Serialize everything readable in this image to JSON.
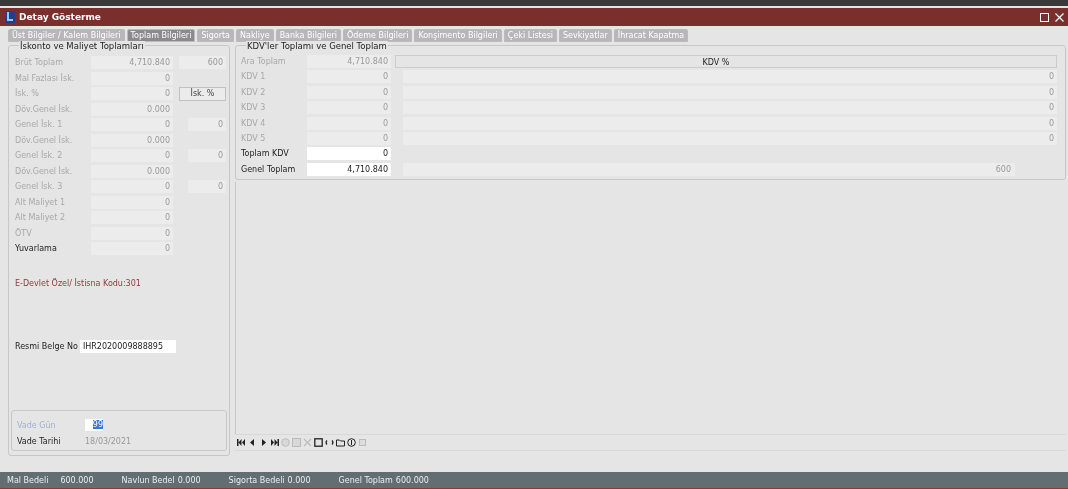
{
  "window": {
    "title": "Detay Gösterme"
  },
  "tabs": [
    {
      "label": "Üst Bilgiler / Kalem Bilgileri",
      "selected": false
    },
    {
      "label": "Toplam Bilgileri",
      "selected": true
    },
    {
      "label": "Sigorta",
      "selected": false
    },
    {
      "label": "Nakliye",
      "selected": false
    },
    {
      "label": "Banka Bilgileri",
      "selected": false
    },
    {
      "label": "Ödeme Bilgileri",
      "selected": false
    },
    {
      "label": "Konşimento Bilgileri",
      "selected": false
    },
    {
      "label": "Çeki Listesi",
      "selected": false
    },
    {
      "label": "Sevkiyatlar",
      "selected": false
    },
    {
      "label": "İhracat Kapatma",
      "selected": false
    }
  ],
  "discount_panel": {
    "title": "İskonto ve Maliyet Toplamları",
    "rows": [
      {
        "label": "Brüt Toplam",
        "value": "4,710.840",
        "disabled": true,
        "extra": {
          "kind": "field",
          "text": "600"
        }
      },
      {
        "label": "Mal Fazlası İsk.",
        "value": "0",
        "disabled": true
      },
      {
        "label": "İsk. %",
        "value": "0",
        "disabled": true,
        "extra": {
          "kind": "button",
          "text": "İsk. %"
        }
      },
      {
        "label": "Döv.Genel İsk.",
        "value": "0.000",
        "disabled": true
      },
      {
        "label": "Genel İsk. 1",
        "value": "0",
        "disabled": true,
        "extra": {
          "kind": "field",
          "text": "0"
        }
      },
      {
        "label": "Döv.Genel İsk.",
        "value": "0.000",
        "disabled": true
      },
      {
        "label": "Genel İsk. 2",
        "value": "0",
        "disabled": true,
        "extra": {
          "kind": "field",
          "text": "0"
        }
      },
      {
        "label": "Döv.Genel İsk.",
        "value": "0.000",
        "disabled": true
      },
      {
        "label": "Genel İsk. 3",
        "value": "0",
        "disabled": true,
        "extra": {
          "kind": "field",
          "text": "0"
        }
      },
      {
        "label": "Alt Maliyet 1",
        "value": "0",
        "disabled": true
      },
      {
        "label": "Alt Maliyet 2",
        "value": "0",
        "disabled": true
      },
      {
        "label": "ÖTV",
        "value": "0",
        "disabled": true
      },
      {
        "label": "Yuvarlama",
        "value": "0",
        "disabled": false
      }
    ],
    "note": "E-Devlet Özel/ İstisna Kodu:301",
    "document": {
      "label": "Resmi Belge No",
      "value": "IHR2020009888895"
    },
    "due": {
      "days_label": "Vade Gün",
      "days_value": "99",
      "days_disabled": true,
      "date_label": "Vade Tarihi",
      "date_value": "18/03/2021"
    }
  },
  "vat_panel": {
    "title": "KDV'ler Toplamı ve Genel Toplam",
    "rate_header": "KDV %",
    "rows": [
      {
        "label": "Ara Toplam",
        "value": "4,710.840",
        "disabled": true
      },
      {
        "label": "KDV 1",
        "value": "0",
        "disabled": true,
        "rate": "0"
      },
      {
        "label": "KDV 2",
        "value": "0",
        "disabled": true,
        "rate": "0"
      },
      {
        "label": "KDV 3",
        "value": "0",
        "disabled": true,
        "rate": "0"
      },
      {
        "label": "KDV 4",
        "value": "0",
        "disabled": true,
        "rate": "0"
      },
      {
        "label": "KDV 5",
        "value": "0",
        "disabled": true,
        "rate": "0"
      },
      {
        "label": "Toplam KDV",
        "value": "0",
        "disabled": false
      },
      {
        "label": "Genel Toplam",
        "value": "4,710.840",
        "disabled": false,
        "rate": "600"
      }
    ]
  },
  "status_bar": [
    {
      "label": "Mal Bedeli",
      "value": "600.000"
    },
    {
      "label": "Navlun Bedel",
      "value": "0.000"
    },
    {
      "label": "Sigorta Bedeli",
      "value": "0.000"
    },
    {
      "label": "Genel Toplam",
      "value": "600.000"
    }
  ]
}
